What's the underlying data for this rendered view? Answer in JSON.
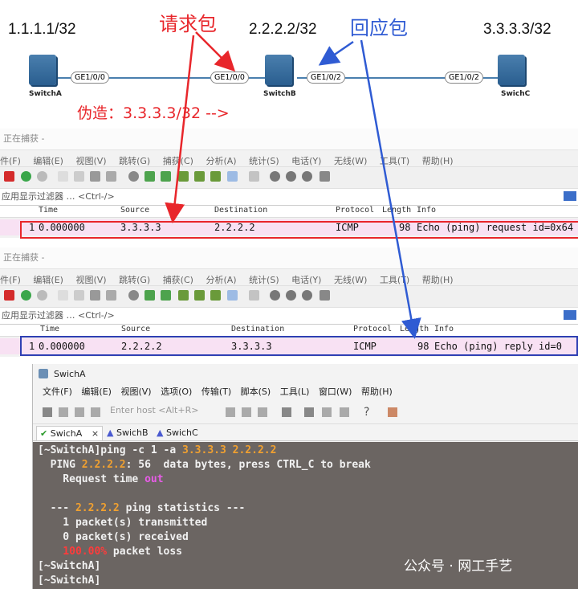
{
  "topology": {
    "ips": [
      "1.1.1.1/32",
      "2.2.2.2/32",
      "3.3.3.3/32"
    ],
    "request_label": "请求包",
    "reply_label": "回应包",
    "forge_label": "伪造：3.3.3.3/32  -->",
    "switches": [
      {
        "name": "SwitchA",
        "ports": [
          "GE1/0/0"
        ]
      },
      {
        "name": "SwitchB",
        "ports": [
          "GE1/0/0",
          "GE1/0/2"
        ]
      },
      {
        "name": "SwichC",
        "ports": [
          "GE1/0/2"
        ]
      }
    ]
  },
  "wireshark": {
    "title": "正在捕获 -",
    "menu": [
      "件(F)",
      "编辑(E)",
      "视图(V)",
      "跳转(G)",
      "捕获(C)",
      "分析(A)",
      "统计(S)",
      "电话(Y)",
      "无线(W)",
      "工具(T)",
      "帮助(H)"
    ],
    "filter_placeholder": "应用显示过滤器 … <Ctrl-/>",
    "columns": [
      "Time",
      "Source",
      "Destination",
      "Protocol",
      "Length",
      "Info"
    ],
    "capture1": {
      "no": "1",
      "time": "0.000000",
      "source": "3.3.3.3",
      "destination": "2.2.2.2",
      "protocol": "ICMP",
      "length": "98",
      "info": "Echo (ping) request  id=0x64"
    },
    "capture2": {
      "no": "1",
      "time": "0.000000",
      "source": "2.2.2.2",
      "destination": "3.3.3.3",
      "protocol": "ICMP",
      "length": "98",
      "info": "Echo (ping) reply    id=0"
    }
  },
  "terminal": {
    "title": "SwichA",
    "menu": [
      "文件(F)",
      "编辑(E)",
      "视图(V)",
      "选项(O)",
      "传输(T)",
      "脚本(S)",
      "工具(L)",
      "窗口(W)",
      "帮助(H)"
    ],
    "host_placeholder": "Enter host <Alt+R>",
    "tabs": [
      "SwichA",
      "SwichB",
      "SwichC"
    ],
    "lines": {
      "prompt1": "[~SwitchA]ping -c 1 -a ",
      "src": "3.3.3.3",
      "dst": "2.2.2.2",
      "ping_pre": "  PING ",
      "ping_ip": "2.2.2.2",
      "ping_post": ": 56  data bytes, press CTRL_C to break",
      "req_pre": "    Request time ",
      "req_out": "out",
      "stat_pre": "  --- ",
      "stat_ip": "2.2.2.2",
      "stat_post": " ping statistics ---",
      "tx": "    1 packet(s) transmitted",
      "rx": "    0 packet(s) received",
      "loss_pct": "    100.00%",
      "loss_post": " packet loss",
      "prompt2": "[~SwitchA]",
      "prompt3": "[~SwitchA]"
    }
  },
  "watermark": "公众号 · 网工手艺",
  "colors": {
    "red": "#e8262b",
    "blue": "#2f5bd3",
    "row": "#f8e1f3"
  }
}
